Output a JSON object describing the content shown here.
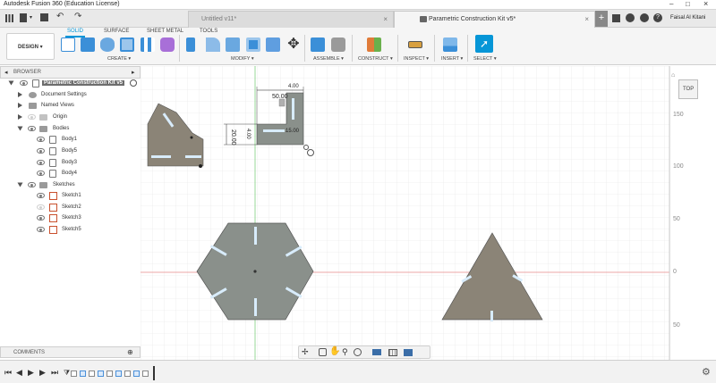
{
  "app": {
    "window_title": "Autodesk Fusion 360 (Education License)"
  },
  "tabs": [
    {
      "label": "Untitled v11*",
      "active": false
    },
    {
      "label": "Parametric Construction Kit v5*",
      "active": true
    }
  ],
  "user": {
    "name": "Faisal Al Kitani"
  },
  "ribbon": {
    "workspace": "DESIGN ▾",
    "tabs": [
      "SOLID",
      "SURFACE",
      "SHEET METAL",
      "TOOLS"
    ],
    "groups": [
      "CREATE ▾",
      "MODIFY ▾",
      "ASSEMBLE ▾",
      "CONSTRUCT ▾",
      "INSPECT ▾",
      "INSERT ▾",
      "SELECT ▾"
    ]
  },
  "browser": {
    "header": "BROWSER",
    "root": "Parametric Construction Kit v5",
    "items": [
      {
        "label": "Document Settings"
      },
      {
        "label": "Named Views"
      },
      {
        "label": "Origin"
      },
      {
        "label": "Bodies"
      },
      {
        "label": "Body1"
      },
      {
        "label": "Body5"
      },
      {
        "label": "Body3"
      },
      {
        "label": "Body4"
      },
      {
        "label": "Sketches"
      },
      {
        "label": "Sketch1"
      },
      {
        "label": "Sketch2"
      },
      {
        "label": "Sketch3"
      },
      {
        "label": "Sketch5"
      }
    ]
  },
  "comments": {
    "header": "COMMENTS"
  },
  "viewcube": {
    "label": "TOP"
  },
  "ruler": {
    "ticks": [
      "150",
      "100",
      "50",
      "0",
      "50"
    ]
  },
  "dimensions": {
    "width": "50.00",
    "height": "20.00",
    "small": "4.00",
    "small2": "4.00",
    "offset": "15.00"
  },
  "colors": {
    "accent": "#0696d7",
    "part_gray": "#8a908b",
    "part_tan": "#8b8477",
    "slot": "#d8ecfb",
    "xaxis": "#e88a8a",
    "yaxis": "#7ed07e"
  }
}
